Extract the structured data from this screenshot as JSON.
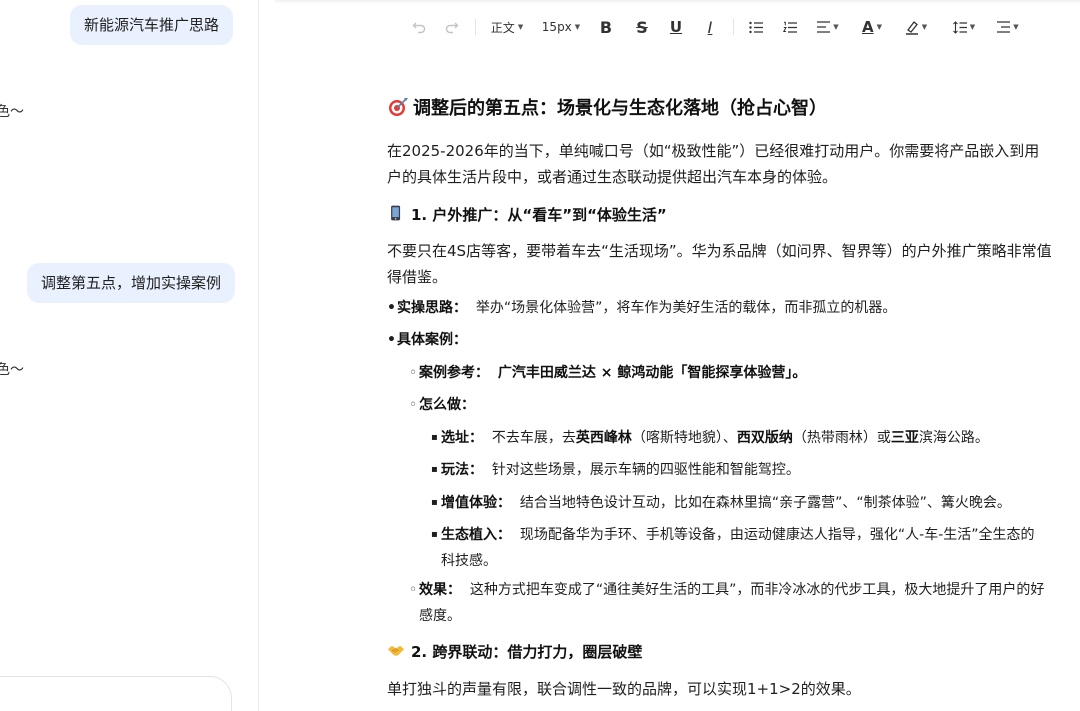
{
  "chat": {
    "messages": [
      {
        "role": "user",
        "text": "新能源汽车推广思路"
      },
      {
        "role": "assistant_fragment",
        "text": "色～"
      },
      {
        "role": "user",
        "text": "调整第五点，增加实操案例"
      },
      {
        "role": "assistant_fragment",
        "text": "色～"
      }
    ]
  },
  "toolbar": {
    "undo_icon": "undo-icon",
    "redo_icon": "redo-icon",
    "paragraph_style": "正文",
    "font_size": "15px",
    "bold": "B",
    "strike": "S",
    "underline": "U",
    "italic": "I",
    "text_color": "A",
    "icons": [
      "bullet-list-icon",
      "ordered-list-icon",
      "align-icon",
      "text-color-icon",
      "highlight-icon",
      "line-height-icon",
      "indent-icon"
    ]
  },
  "doc": {
    "heading": "调整后的第五点：场景化与生态化落地（抢占心智）",
    "intro": "在2025-2026年的当下，单纯喊口号（如“极致性能”）已经很难打动用户。你需要将产品嵌入到用户的具体生活片段中，或者通过生态联动提供超出汽车本身的体验。",
    "section1": {
      "title": "1. 户外推广：从“看车”到“体验生活”",
      "intro": "不要只在4S店等客，要带着车去“生活现场”。华为系品牌（如问界、智界等）的户外推广策略非常值得借鉴。",
      "strategy_label": "实操思路：",
      "strategy_text": "举办“场景化体验营”，将车作为美好生活的载体，而非孤立的机器。",
      "cases_label": "具体案例：",
      "case_ref_label": "案例参考：",
      "case_ref_text": "广汽丰田威兰达 × 鲸鸿动能「智能探享体验营」。",
      "how_label": "怎么做：",
      "steps": [
        {
          "label": "选址：",
          "parts": [
            [
              "不去车展，去",
              false
            ],
            [
              "英西峰林",
              true
            ],
            [
              "（喀斯特地貌）、",
              false
            ],
            [
              "西双版纳",
              true
            ],
            [
              "（热带雨林）或",
              false
            ],
            [
              "三亚",
              true
            ],
            [
              "滨海公路。",
              false
            ]
          ]
        },
        {
          "label": "玩法：",
          "parts": [
            [
              "针对这些场景，展示车辆的四驱性能和智能驾控。",
              false
            ]
          ]
        },
        {
          "label": "增值体验：",
          "parts": [
            [
              "结合当地特色设计互动，比如在森林里搞“亲子露营”、“制茶体验”、篝火晚会。",
              false
            ]
          ]
        },
        {
          "label": "生态植入：",
          "parts": [
            [
              "现场配备华为手环、手机等设备，由运动健康达人指导，强化“人-车-生活”全生态的科技感。",
              false
            ]
          ]
        }
      ],
      "effect_label": "效果：",
      "effect_text": "这种方式把车变成了“通往美好生活的工具”，而非冷冰冰的代步工具，极大地提升了用户的好感度。"
    },
    "section2": {
      "title": "2. 跨界联动：借力打力，圈层破壁",
      "intro": "单打独斗的声量有限，联合调性一致的品牌，可以实现1+1>2的效果。"
    }
  }
}
